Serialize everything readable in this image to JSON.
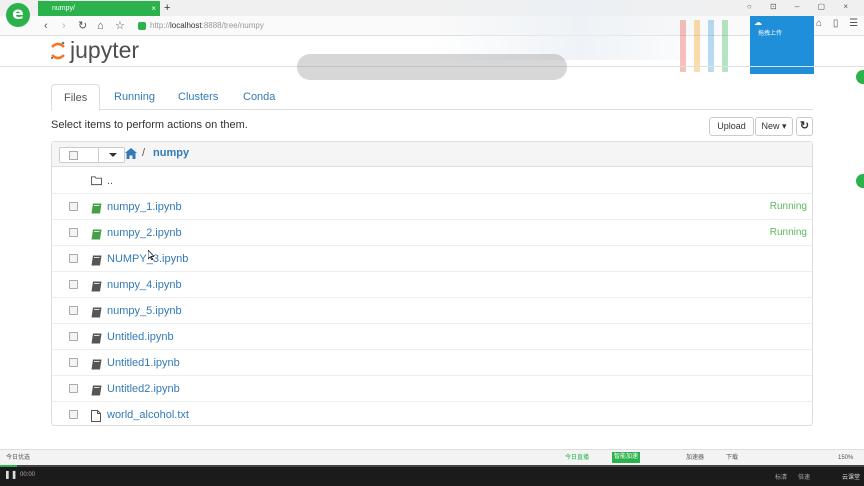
{
  "browser": {
    "logo": "e",
    "tab_title": "numpy/",
    "tab_close": "×",
    "new_tab": "+",
    "url_prefix": "http://",
    "url_host": "localhost",
    "url_rest": ":8888/tree/numpy",
    "upload_label": "拖拽上传",
    "nav": {
      "back": "‹",
      "forward": "›",
      "reload": "↻",
      "home": "⌂",
      "star": "☆"
    }
  },
  "jupyter": {
    "logo_text": "jupyter",
    "tabs": [
      "Files",
      "Running",
      "Clusters",
      "Conda"
    ],
    "active_tab": 0,
    "hint": "Select items to perform actions on them.",
    "upload_button": "Upload",
    "new_button": "New",
    "new_caret": "▾",
    "refresh_icon": "↻",
    "breadcrumb": {
      "slash": "/",
      "dir": "numpy"
    },
    "parent_dir": "..",
    "files": [
      {
        "name": "numpy_1.ipynb",
        "type": "notebook",
        "running": true,
        "status": "Running"
      },
      {
        "name": "numpy_2.ipynb",
        "type": "notebook",
        "running": true,
        "status": "Running"
      },
      {
        "name": "NUMPY_3.ipynb",
        "type": "notebook",
        "running": false,
        "status": ""
      },
      {
        "name": "numpy_4.ipynb",
        "type": "notebook",
        "running": false,
        "status": ""
      },
      {
        "name": "numpy_5.ipynb",
        "type": "notebook",
        "running": false,
        "status": ""
      },
      {
        "name": "Untitled.ipynb",
        "type": "notebook",
        "running": false,
        "status": ""
      },
      {
        "name": "Untitled1.ipynb",
        "type": "notebook",
        "running": false,
        "status": ""
      },
      {
        "name": "Untitled2.ipynb",
        "type": "notebook",
        "running": false,
        "status": ""
      },
      {
        "name": "world_alcohol.txt",
        "type": "file",
        "running": false,
        "status": ""
      }
    ]
  },
  "statusbar": {
    "left": "今日优选",
    "live": "今日直播",
    "smart": "智能加速",
    "accelerator": "加速器",
    "download": "下载",
    "zoom": "150%"
  },
  "player": {
    "time": "00:00",
    "progress": 0.02,
    "quality": "标清",
    "speed": "倍速",
    "brand": "云课堂"
  },
  "colors": {
    "link": "#337ab7",
    "running": "#5cb85c",
    "notebook_icon": "#43a047",
    "browser_green": "#2bb24c"
  }
}
